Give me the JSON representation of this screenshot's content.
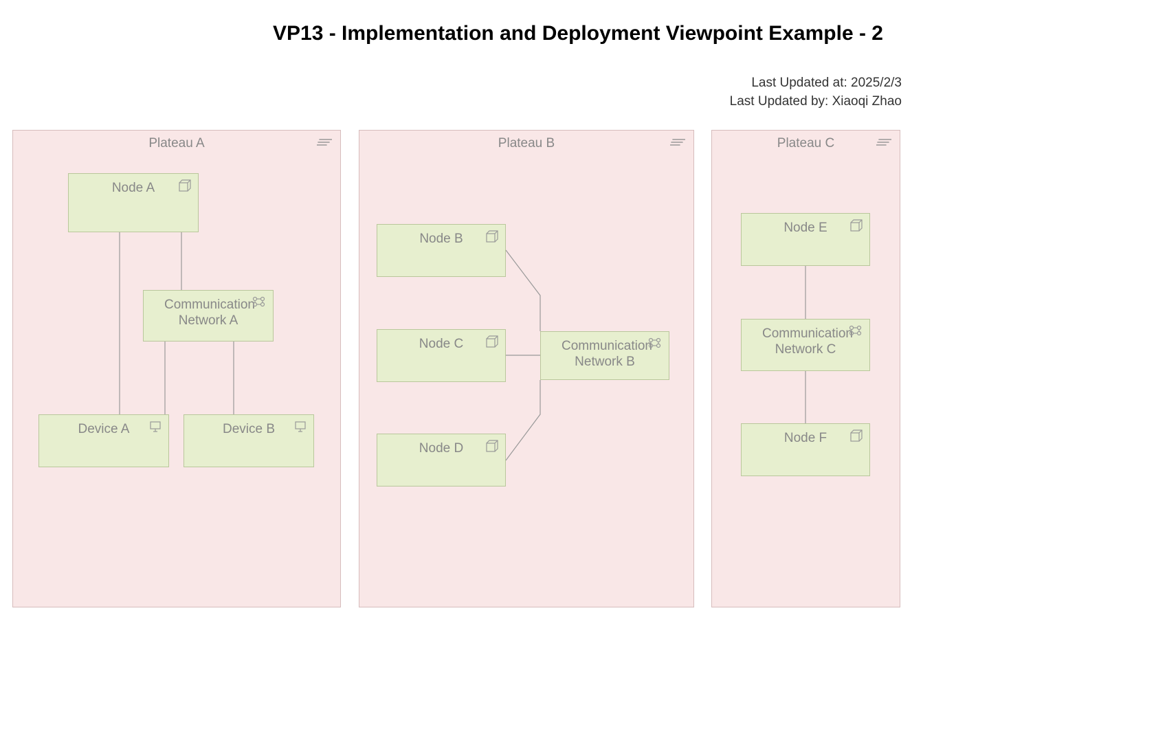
{
  "title": "VP13 - Implementation and Deployment Viewpoint Example - 2",
  "meta": {
    "updated_at_label": "Last Updated at: 2025/2/3",
    "updated_by_label": "Last Updated by: Xiaoqi Zhao"
  },
  "plateaus": {
    "a": {
      "label": "Plateau A"
    },
    "b": {
      "label": "Plateau B"
    },
    "c": {
      "label": "Plateau C"
    }
  },
  "nodes": {
    "node_a": {
      "label": "Node A",
      "type": "node"
    },
    "comm_a": {
      "label": "Communication Network A",
      "type": "network"
    },
    "device_a": {
      "label": "Device A",
      "type": "device"
    },
    "device_b": {
      "label": "Device B",
      "type": "device"
    },
    "node_b": {
      "label": "Node B",
      "type": "node"
    },
    "node_c": {
      "label": "Node C",
      "type": "node"
    },
    "node_d": {
      "label": "Node D",
      "type": "node"
    },
    "comm_b": {
      "label": "Communication Network B",
      "type": "network"
    },
    "node_e": {
      "label": "Node E",
      "type": "node"
    },
    "comm_c": {
      "label": "Communication Network C",
      "type": "network"
    },
    "node_f": {
      "label": "Node F",
      "type": "node"
    }
  },
  "edges": [
    [
      "node_a",
      "comm_a"
    ],
    [
      "node_a",
      "device_a"
    ],
    [
      "comm_a",
      "device_a"
    ],
    [
      "comm_a",
      "device_b"
    ],
    [
      "node_b",
      "comm_b"
    ],
    [
      "node_c",
      "comm_b"
    ],
    [
      "node_d",
      "comm_b"
    ],
    [
      "node_e",
      "comm_c"
    ],
    [
      "comm_c",
      "node_f"
    ]
  ]
}
